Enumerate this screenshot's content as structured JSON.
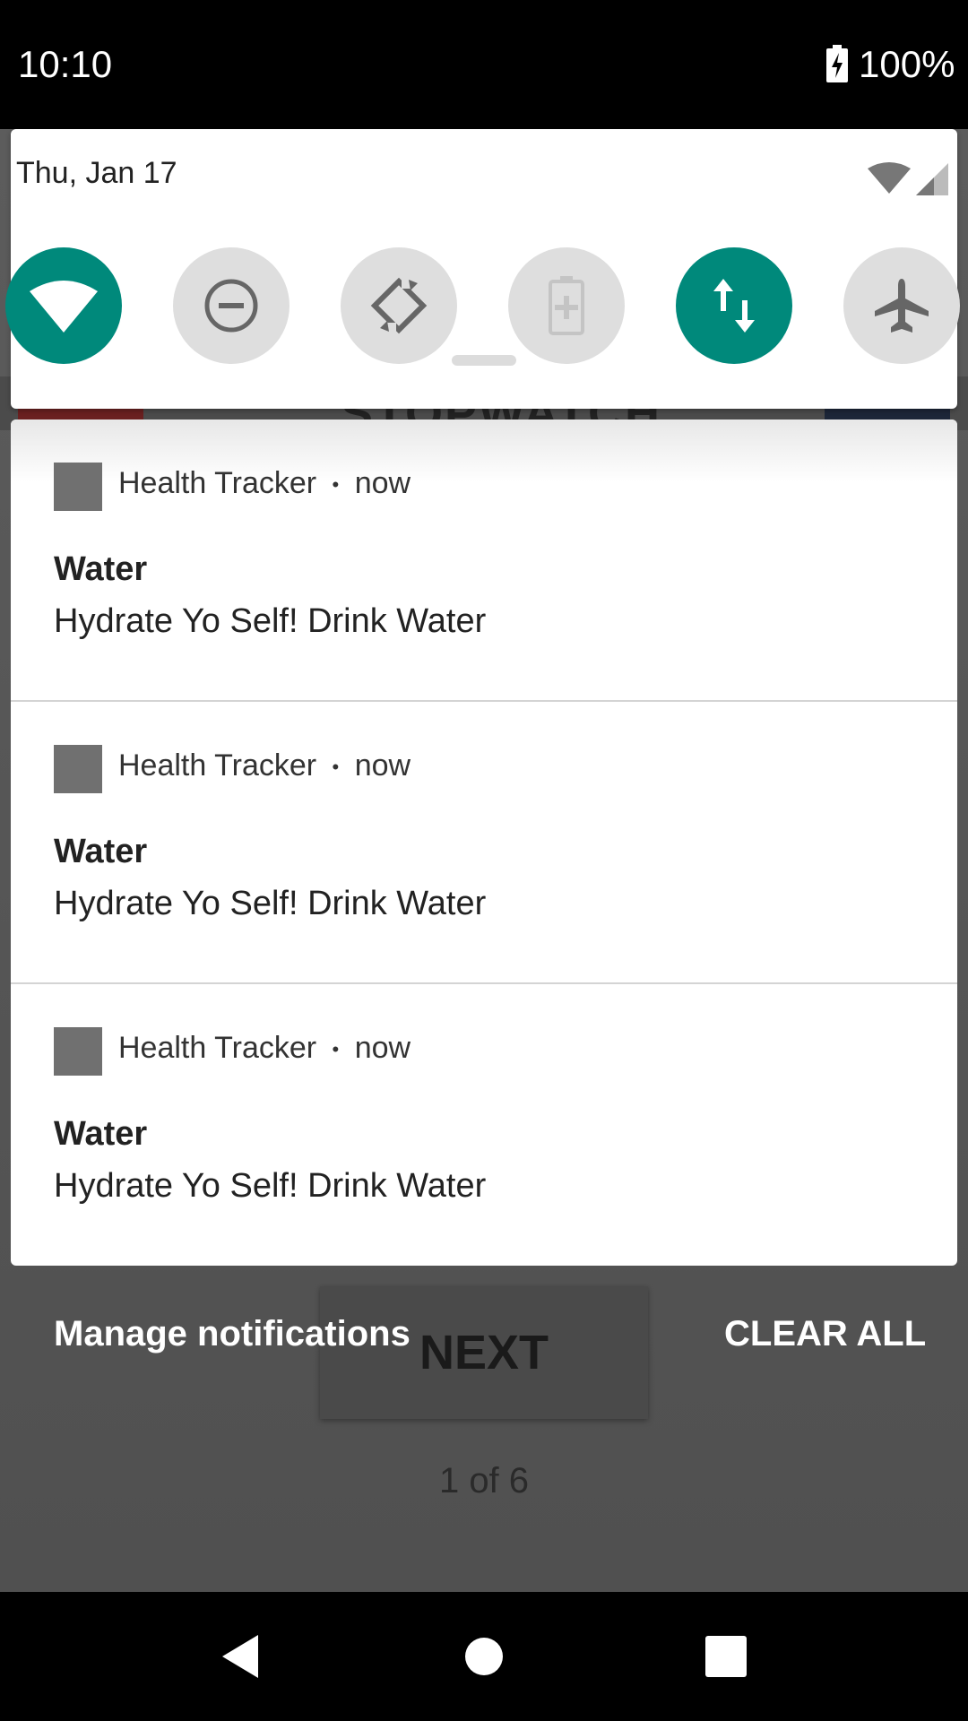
{
  "status_bar": {
    "time": "10:10",
    "battery": "100%",
    "icons": [
      "battery-charging-icon"
    ]
  },
  "quick_settings": {
    "date": "Thu, Jan 17",
    "tiles": [
      {
        "name": "wifi",
        "icon": "wifi-icon",
        "state": "on"
      },
      {
        "name": "do-not-disturb",
        "icon": "dnd-icon",
        "state": "off"
      },
      {
        "name": "auto-rotate",
        "icon": "rotate-icon",
        "state": "off"
      },
      {
        "name": "battery-saver",
        "icon": "battery-saver-icon",
        "state": "off"
      },
      {
        "name": "mobile-data",
        "icon": "data-icon",
        "state": "on"
      },
      {
        "name": "airplane-mode",
        "icon": "airplane-icon",
        "state": "off"
      }
    ]
  },
  "notifications": [
    {
      "app": "Health Tracker",
      "separator": "•",
      "time": "now",
      "title": "Water",
      "text": "Hydrate Yo Self! Drink Water"
    },
    {
      "app": "Health Tracker",
      "separator": "•",
      "time": "now",
      "title": "Water",
      "text": "Hydrate Yo Self! Drink Water"
    },
    {
      "app": "Health Tracker",
      "separator": "•",
      "time": "now",
      "title": "Water",
      "text": "Hydrate Yo Self! Drink Water"
    }
  ],
  "actions": {
    "manage": "Manage notifications",
    "clear_all": "CLEAR ALL"
  },
  "background_app": {
    "heading": "STOPWATCH",
    "next_button": "NEXT",
    "page_counter": "1 of 6"
  },
  "colors": {
    "tile_on": "#00897b",
    "tile_off": "#dedede",
    "scrim": "#5a5a5a"
  },
  "nav_bar": {
    "buttons": [
      "back-icon",
      "home-icon",
      "recents-icon"
    ]
  }
}
